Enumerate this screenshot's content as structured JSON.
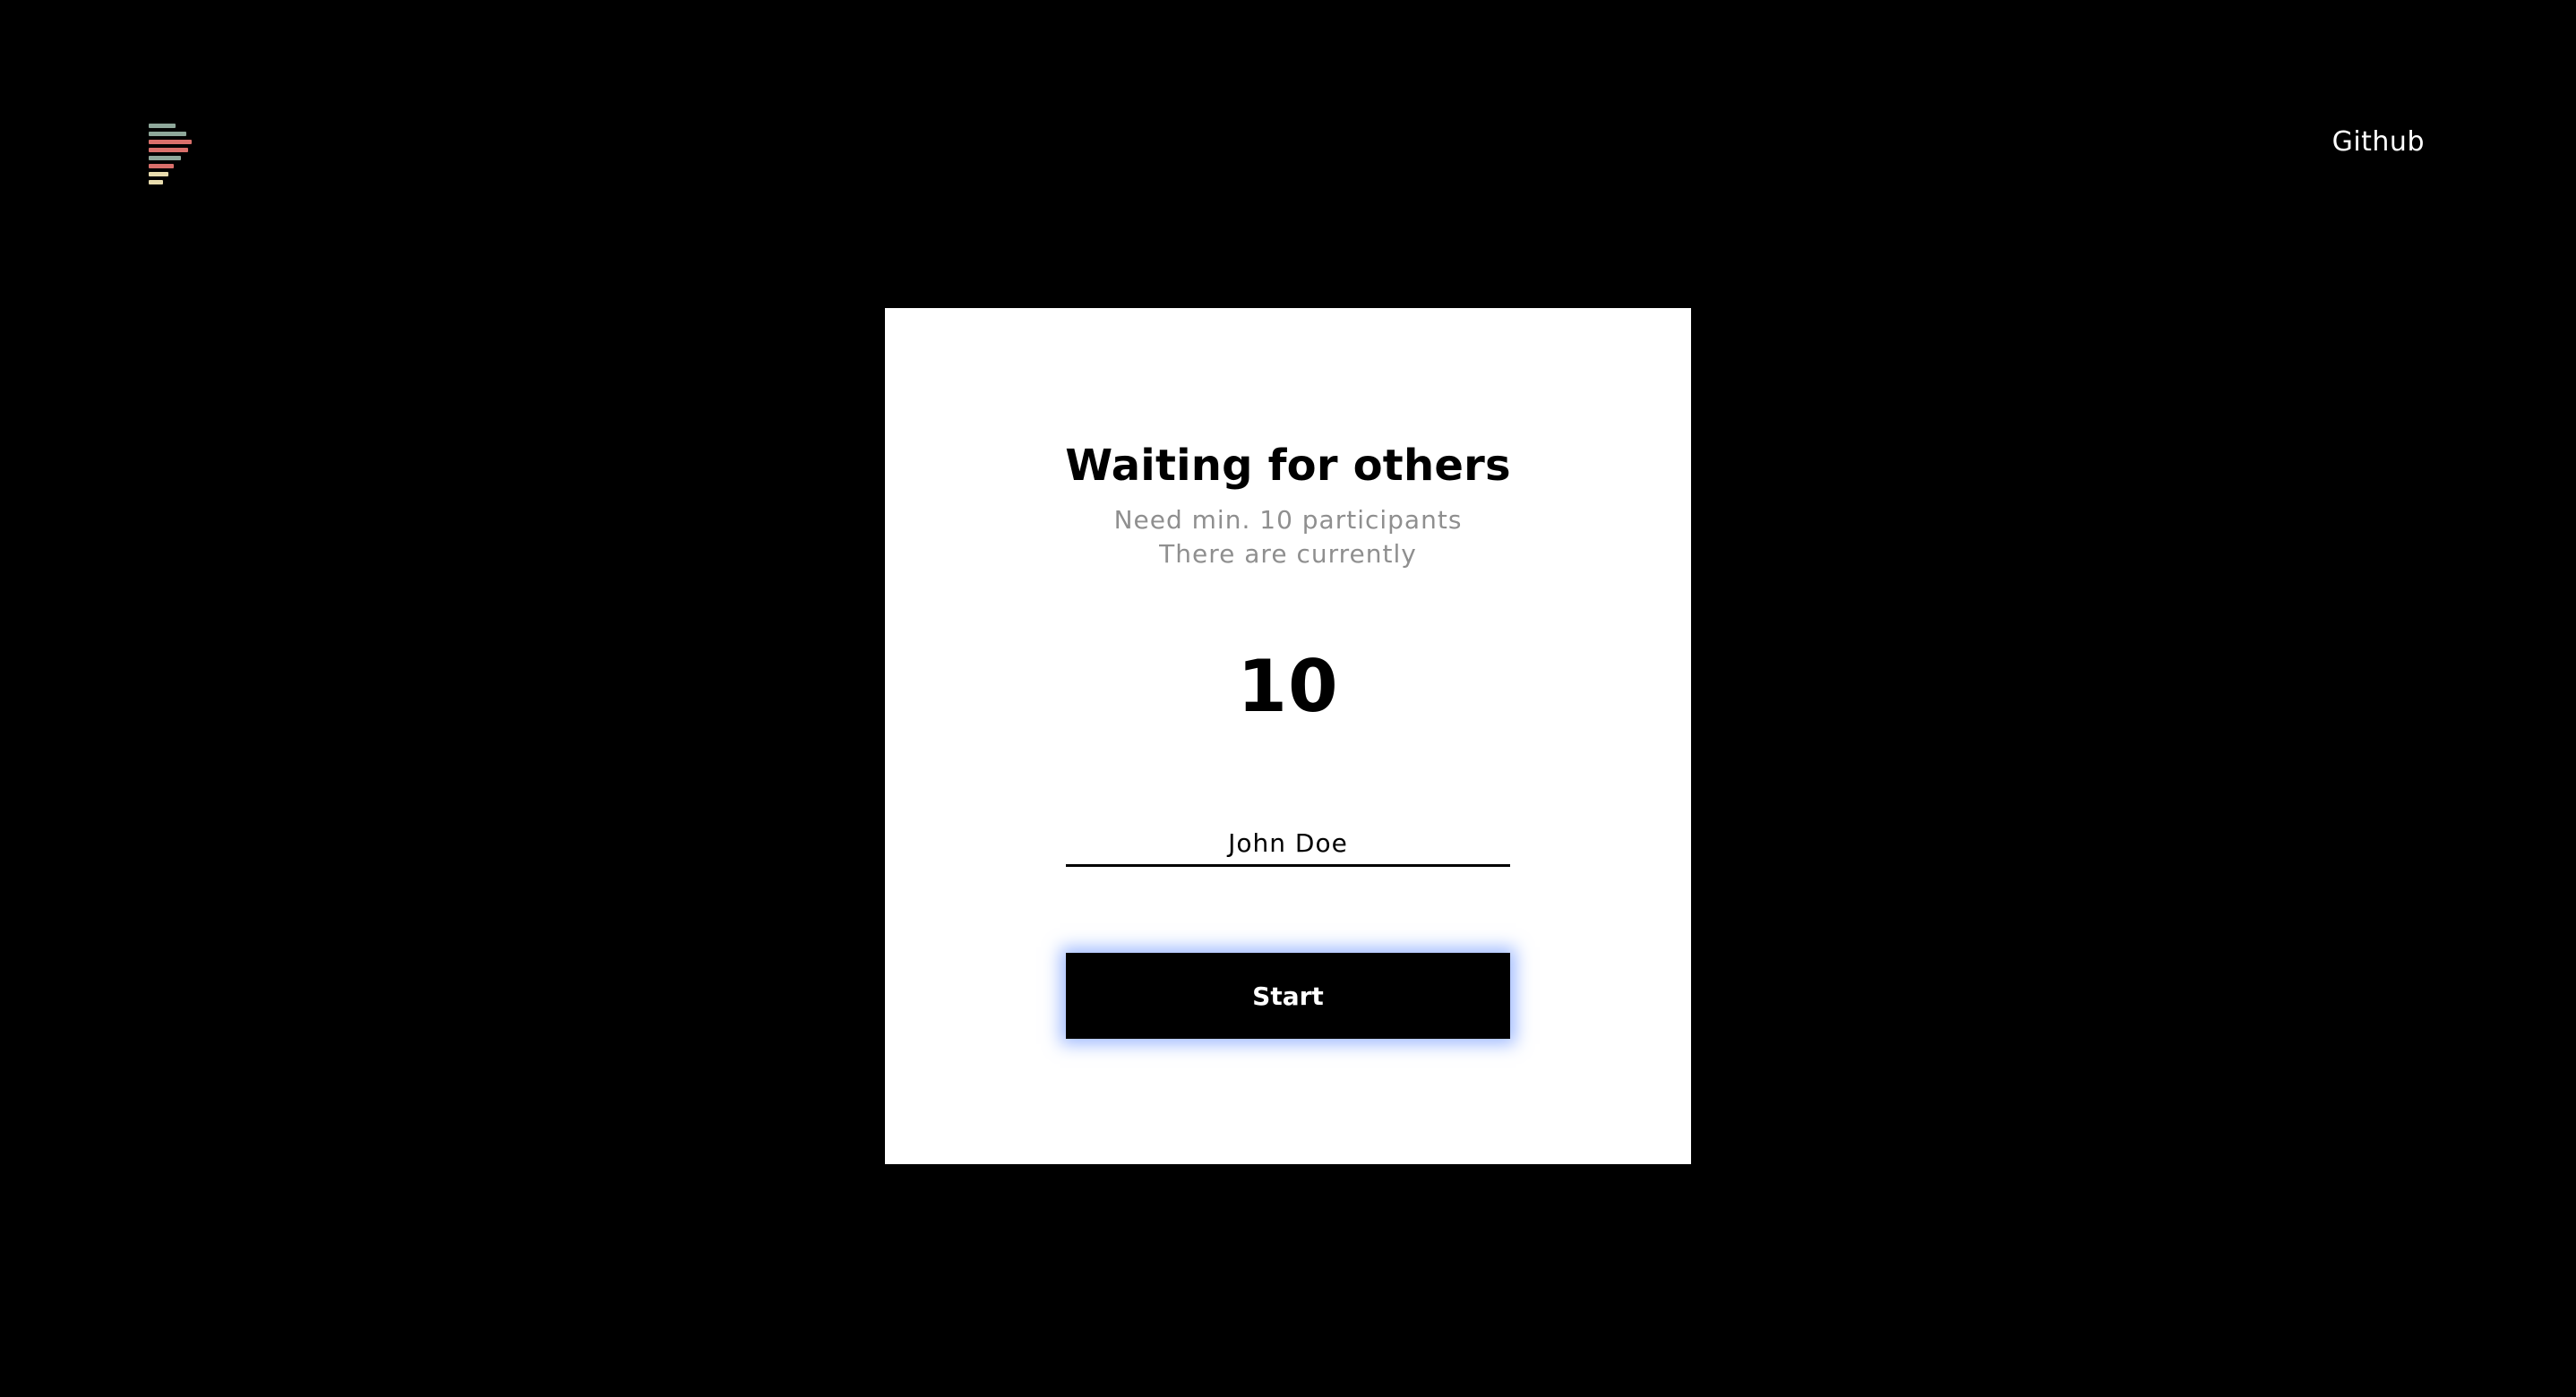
{
  "header": {
    "logo_colors": [
      "#8ea79a",
      "#8ea79a",
      "#d96f6a",
      "#d96f6a",
      "#8ea79a",
      "#d96f6a",
      "#e8dcae",
      "#e8dcae"
    ],
    "github_label": "Github"
  },
  "card": {
    "title": "Waiting for others",
    "subtitle_line1": "Need min. 10 participants",
    "subtitle_line2": "There are currently",
    "participant_count": "10",
    "name_input_value": "John Doe",
    "start_label": "Start"
  },
  "colors": {
    "background": "#000000",
    "card_background": "#ffffff",
    "subtitle": "#8f8f8f",
    "button_glow": "#5082ff"
  }
}
